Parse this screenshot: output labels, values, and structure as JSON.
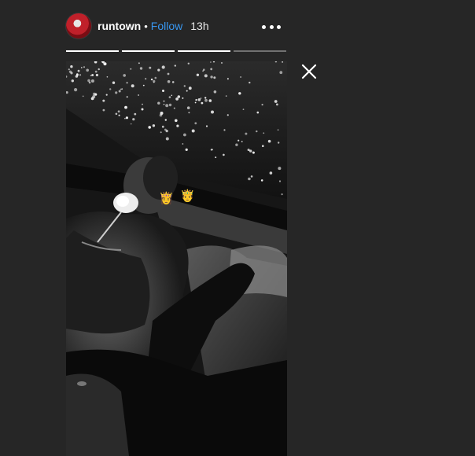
{
  "story": {
    "username": "runtown",
    "separator": "•",
    "follow_label": "Follow",
    "time_ago": "13h",
    "progress": [
      1,
      1,
      1,
      0
    ],
    "stickers": [
      "👸",
      "🤴"
    ]
  },
  "colors": {
    "background": "#262626",
    "follow": "#3897f0",
    "text": "#ffffff"
  },
  "icons": {
    "more": "more-options-icon",
    "close": "close-icon"
  }
}
